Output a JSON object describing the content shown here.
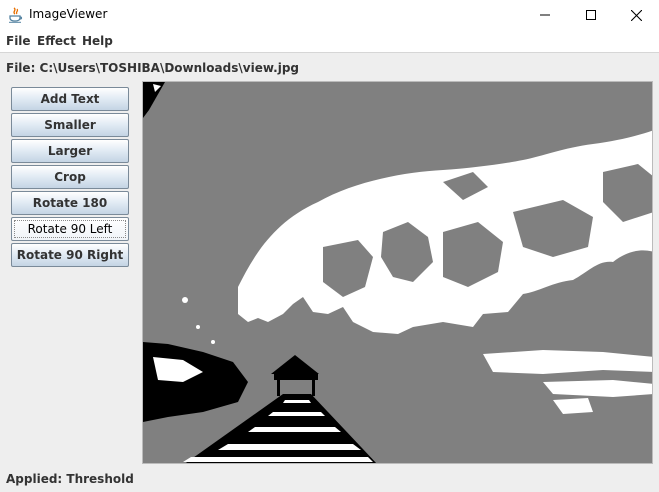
{
  "window": {
    "title": "ImageViewer"
  },
  "menu": {
    "items": [
      "File",
      "Effect",
      "Help"
    ]
  },
  "file_label": "File: C:\\Users\\TOSHIBA\\Downloads\\view.jpg",
  "buttons": [
    "Add Text",
    "Smaller",
    "Larger",
    "Crop",
    "Rotate 180",
    "Rotate 90 Left",
    "Rotate 90 Right"
  ],
  "focused_button": "Rotate 90 Left",
  "status": "Applied: Threshold",
  "image": {
    "effect": "threshold",
    "colors": {
      "dark": "#000000",
      "mid": "#808080",
      "light": "#ffffff"
    }
  }
}
